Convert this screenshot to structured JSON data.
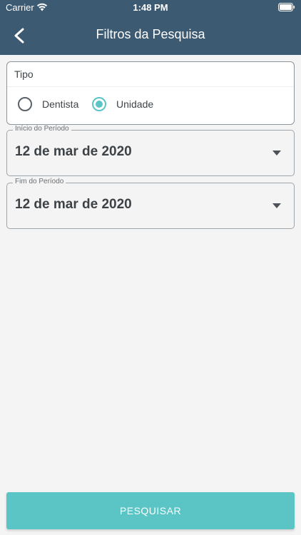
{
  "status_bar": {
    "carrier": "Carrier",
    "time": "1:48 PM"
  },
  "header": {
    "title": "Filtros da Pesquisa",
    "back_icon": "chevron-left-icon",
    "background": "#3d5a73"
  },
  "tipo": {
    "label": "Tipo",
    "options": [
      {
        "label": "Dentista",
        "selected": false
      },
      {
        "label": "Unidade",
        "selected": true
      }
    ]
  },
  "inicio_periodo": {
    "label": "Início do Período",
    "value": "12 de mar de 2020"
  },
  "fim_periodo": {
    "label": "Fim do Período",
    "value": "12 de mar de 2020"
  },
  "search_button": {
    "label": "PESQUISAR",
    "color": "#5bc5c6"
  }
}
